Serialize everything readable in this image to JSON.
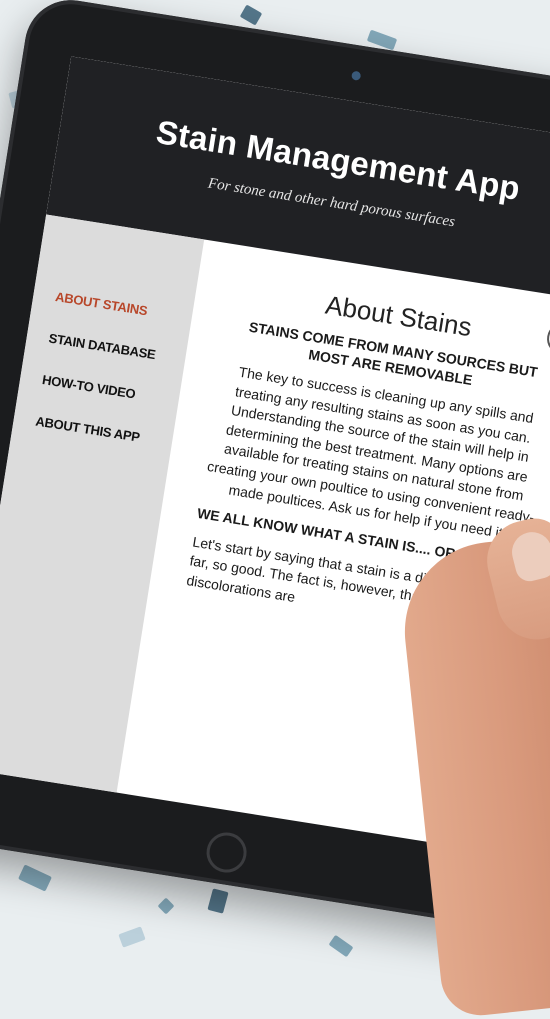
{
  "app": {
    "title": "Stain Management App",
    "subtitle": "For stone and other hard porous surfaces"
  },
  "nav": {
    "items": [
      {
        "label": "ABOUT STAINS",
        "active": true
      },
      {
        "label": "STAIN DATABASE",
        "active": false
      },
      {
        "label": "HOW-TO VIDEO",
        "active": false
      },
      {
        "label": "ABOUT THIS APP",
        "active": false
      }
    ]
  },
  "content": {
    "page_title": "About Stains",
    "section1_heading": "STAINS COME FROM MANY SOURCES BUT MOST ARE REMOVABLE",
    "section1_body": "The key to success is cleaning up any spills and treating any resulting stains as soon as you can. Understanding the source of the stain will help in determining the best treatment. Many options are available for treating stains on natural stone from creating your own poultice to using convenient ready-made poultices. Ask us for help if you need it.",
    "section2_heading": "WE ALL KNOW WHAT A STAIN IS.... OR DO WE?",
    "section2_body": "Let's start by saying that a stain is a discoloration. So far, so good. The fact is, however, that not all discolorations are"
  },
  "icons": {
    "print": "printer-icon",
    "camera": "camera-icon",
    "home": "home-button-icon"
  },
  "colors": {
    "accent": "#b8472a",
    "header_bg": "#202124",
    "sidebar_bg": "#dcdcdc"
  }
}
